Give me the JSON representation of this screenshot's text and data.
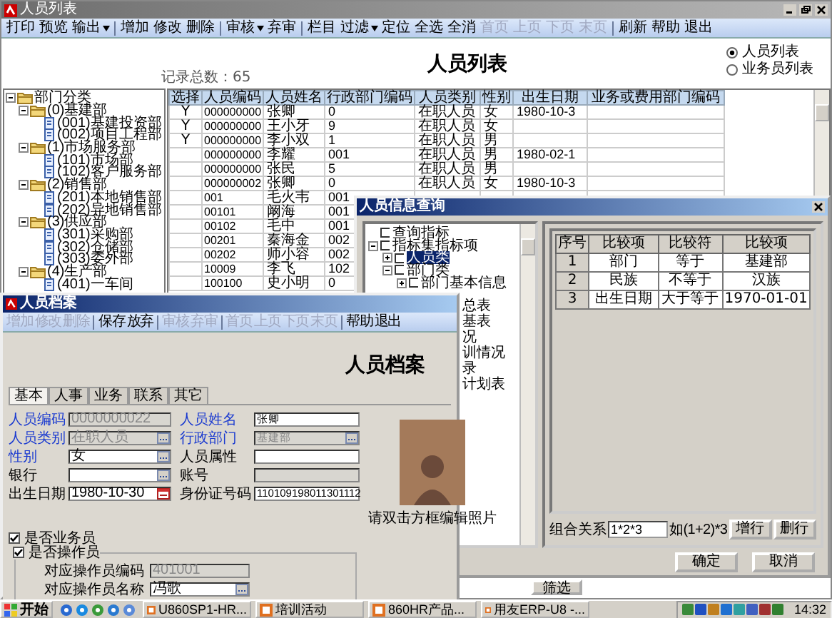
{
  "main_window": {
    "title": "人员列表",
    "toolbar": [
      {
        "kind": "button",
        "label": "打印",
        "disabled": false
      },
      {
        "kind": "button",
        "label": "预览",
        "disabled": false
      },
      {
        "kind": "menu",
        "label": "输出",
        "disabled": false
      },
      {
        "kind": "sep"
      },
      {
        "kind": "button",
        "label": "增加",
        "disabled": false
      },
      {
        "kind": "button",
        "label": "修改",
        "disabled": false
      },
      {
        "kind": "button",
        "label": "删除",
        "disabled": false
      },
      {
        "kind": "sep"
      },
      {
        "kind": "menu",
        "label": "审核",
        "disabled": false
      },
      {
        "kind": "button",
        "label": "弃审",
        "disabled": false
      },
      {
        "kind": "sep"
      },
      {
        "kind": "button",
        "label": "栏目",
        "disabled": false
      },
      {
        "kind": "menu",
        "label": "过滤",
        "disabled": false
      },
      {
        "kind": "button",
        "label": "定位",
        "disabled": false
      },
      {
        "kind": "button",
        "label": "全选",
        "disabled": false
      },
      {
        "kind": "button",
        "label": "全消",
        "disabled": false
      },
      {
        "kind": "button",
        "label": "首页",
        "disabled": true
      },
      {
        "kind": "button",
        "label": "上页",
        "disabled": true
      },
      {
        "kind": "button",
        "label": "下页",
        "disabled": true
      },
      {
        "kind": "button",
        "label": "末页",
        "disabled": true
      },
      {
        "kind": "sep"
      },
      {
        "kind": "button",
        "label": "刷新",
        "disabled": false
      },
      {
        "kind": "button",
        "label": "帮助",
        "disabled": false
      },
      {
        "kind": "button",
        "label": "退出",
        "disabled": false
      }
    ],
    "record_count": "记录总数：65",
    "heading": "人员列表",
    "view_options": [
      {
        "label": "人员列表",
        "selected": true
      },
      {
        "label": "业务员列表",
        "selected": false
      }
    ],
    "tree": [
      {
        "label": "部门分类",
        "kind": "folder",
        "expanded": true,
        "children": [
          {
            "label": "(0)基建部",
            "kind": "folder",
            "expanded": true,
            "children": [
              {
                "label": "(001)基建投资部",
                "kind": "page"
              },
              {
                "label": "(002)项目工程部",
                "kind": "page"
              }
            ]
          },
          {
            "label": "(1)市场服务部",
            "kind": "folder",
            "expanded": true,
            "children": [
              {
                "label": "(101)市场部",
                "kind": "page"
              },
              {
                "label": "(102)客户服务部",
                "kind": "page"
              }
            ]
          },
          {
            "label": "(2)销售部",
            "kind": "folder",
            "expanded": true,
            "children": [
              {
                "label": "(201)本地销售部",
                "kind": "page"
              },
              {
                "label": "(202)异地销售部",
                "kind": "page"
              }
            ]
          },
          {
            "label": "(3)供应部",
            "kind": "folder",
            "expanded": true,
            "children": [
              {
                "label": "(301)采购部",
                "kind": "page"
              },
              {
                "label": "(302)仓储部",
                "kind": "page"
              },
              {
                "label": "(303)委外部",
                "kind": "page"
              }
            ]
          },
          {
            "label": "(4)生产部",
            "kind": "folder",
            "expanded": true,
            "children": [
              {
                "label": "(401)一车间",
                "kind": "page"
              }
            ]
          }
        ]
      }
    ],
    "table": {
      "columns": [
        "选择",
        "人员编码",
        "人员姓名",
        "行政部门编码",
        "人员类别",
        "性别",
        "出生日期",
        "业务或费用部门编码"
      ],
      "rows": [
        [
          "Y",
          "000000000",
          "张卿",
          "0",
          "在职人员",
          "女",
          "1980-10-3"
        ],
        [
          "Y",
          "000000000",
          "王小牙",
          "9",
          "在职人员",
          "女"
        ],
        [
          "Y",
          "000000000",
          "李小双",
          "1",
          "在职人员",
          "男"
        ],
        [
          null,
          "000000000",
          "李耀",
          "001",
          "在职人员",
          "男",
          "1980-02-1"
        ],
        [
          null,
          "000000000",
          "张民",
          "5",
          "在职人员",
          "男"
        ],
        [
          null,
          "000000002",
          "张卿",
          "0",
          "在职人员",
          "女",
          "1980-10-3"
        ],
        [
          null,
          "001",
          "毛火韦",
          "001"
        ],
        [
          null,
          "00101",
          "阚海",
          "001"
        ],
        [
          null,
          "00102",
          "毛中",
          "001"
        ],
        [
          null,
          "00201",
          "秦海金",
          "002"
        ],
        [
          null,
          "00202",
          "师小容",
          "002"
        ],
        [
          null,
          "10009",
          "李飞",
          "102"
        ],
        [
          null,
          "100100",
          "史小明",
          "0"
        ]
      ]
    },
    "bottom_button": "筛选"
  },
  "query_dialog": {
    "title": "人员信息查询",
    "tree": [
      {
        "label": "查询指标",
        "selected": false
      },
      {
        "label": "指标集指标项",
        "selected": false,
        "expanded": true,
        "children": [
          {
            "label": "人员类",
            "selected": true,
            "expanded": false
          },
          {
            "label": "部门类",
            "selected": false,
            "expanded": true,
            "children": [
              {
                "label": "部门基本信息",
                "selected": false,
                "expanded": false
              }
            ]
          }
        ]
      }
    ],
    "tree_fragments": [
      "总表",
      "基表",
      "况",
      "训情况",
      "录",
      "计划表"
    ],
    "grid": {
      "columns": [
        "序号",
        "比较项",
        "比较符",
        "比较项"
      ],
      "rows": [
        [
          "1",
          "部门",
          "等于",
          "基建部"
        ],
        [
          "2",
          "民族",
          "不等于",
          "汉族"
        ],
        [
          "3",
          "出生日期",
          "大于等于",
          "1970-01-01"
        ]
      ]
    },
    "relation": {
      "label": "组合关系",
      "value": "1*2*3",
      "hint": "如(1+2)*3"
    },
    "row_buttons": [
      "增行",
      "删行"
    ],
    "buttons": [
      "确定",
      "取消"
    ]
  },
  "archive_window": {
    "title": "人员档案",
    "toolbar": [
      {
        "kind": "button",
        "label": "增加",
        "disabled": true
      },
      {
        "kind": "button",
        "label": "修改",
        "disabled": true
      },
      {
        "kind": "button",
        "label": "删除",
        "disabled": true
      },
      {
        "kind": "sep"
      },
      {
        "kind": "button",
        "label": "保存",
        "disabled": false
      },
      {
        "kind": "button",
        "label": "放弃",
        "disabled": false
      },
      {
        "kind": "sep"
      },
      {
        "kind": "button",
        "label": "审核",
        "disabled": true
      },
      {
        "kind": "button",
        "label": "弃审",
        "disabled": true
      },
      {
        "kind": "sep"
      },
      {
        "kind": "button",
        "label": "首页",
        "disabled": true
      },
      {
        "kind": "button",
        "label": "上页",
        "disabled": true
      },
      {
        "kind": "button",
        "label": "下页",
        "disabled": true
      },
      {
        "kind": "button",
        "label": "末页",
        "disabled": true
      },
      {
        "kind": "sep"
      },
      {
        "kind": "button",
        "label": "帮助",
        "disabled": false
      },
      {
        "kind": "button",
        "label": "退出",
        "disabled": false
      }
    ],
    "heading": "人员档案",
    "tabs": [
      {
        "label": "基本",
        "selected": true
      },
      {
        "label": "人事",
        "selected": false
      },
      {
        "label": "业务",
        "selected": false
      },
      {
        "label": "联系",
        "selected": false
      },
      {
        "label": "其它",
        "selected": false
      }
    ],
    "left_fields": [
      {
        "label": "人员编码",
        "required": true,
        "kind": "text",
        "value": "0000000022",
        "disabled": true
      },
      {
        "label": "人员类别",
        "required": true,
        "kind": "lookup",
        "value": "在职人员",
        "disabled": true
      },
      {
        "label": "性别",
        "required": true,
        "kind": "lookup",
        "value": "女",
        "disabled": false
      },
      {
        "label": "银行",
        "required": false,
        "kind": "lookup",
        "disabled": false
      },
      {
        "label": "出生日期",
        "required": false,
        "kind": "date",
        "value": "1980-10-30",
        "disabled": false
      }
    ],
    "right_fields": [
      {
        "label": "人员姓名",
        "required": true,
        "kind": "text",
        "value": "张卿",
        "disabled": false
      },
      {
        "label": "行政部门",
        "required": true,
        "kind": "lookup",
        "value": "基建部",
        "disabled": true
      },
      {
        "label": "人员属性",
        "required": false,
        "kind": "text",
        "disabled": false
      },
      {
        "label": "账号",
        "required": false,
        "kind": "text",
        "disabled": true
      },
      {
        "label": "身份证号码",
        "required": false,
        "kind": "text",
        "value": "110109198011301112",
        "disabled": false
      }
    ],
    "checkboxes": [
      {
        "label": "是否业务员",
        "checked": true
      },
      {
        "label": "是否操作员",
        "checked": true
      }
    ],
    "operator_fields": [
      {
        "label": "对应操作员编码",
        "kind": "text",
        "value": "401001",
        "disabled": true
      },
      {
        "label": "对应操作员名称",
        "kind": "lookup",
        "value": "冯歌",
        "disabled": false
      }
    ],
    "photo_caption": "请双击方框编辑照片"
  },
  "taskbar": {
    "start": "开始",
    "tasks": [
      "U860SP1-HR...",
      "培训活动",
      "860HR产品...",
      "用友ERP-U8 -..."
    ],
    "clock": "14:32"
  }
}
